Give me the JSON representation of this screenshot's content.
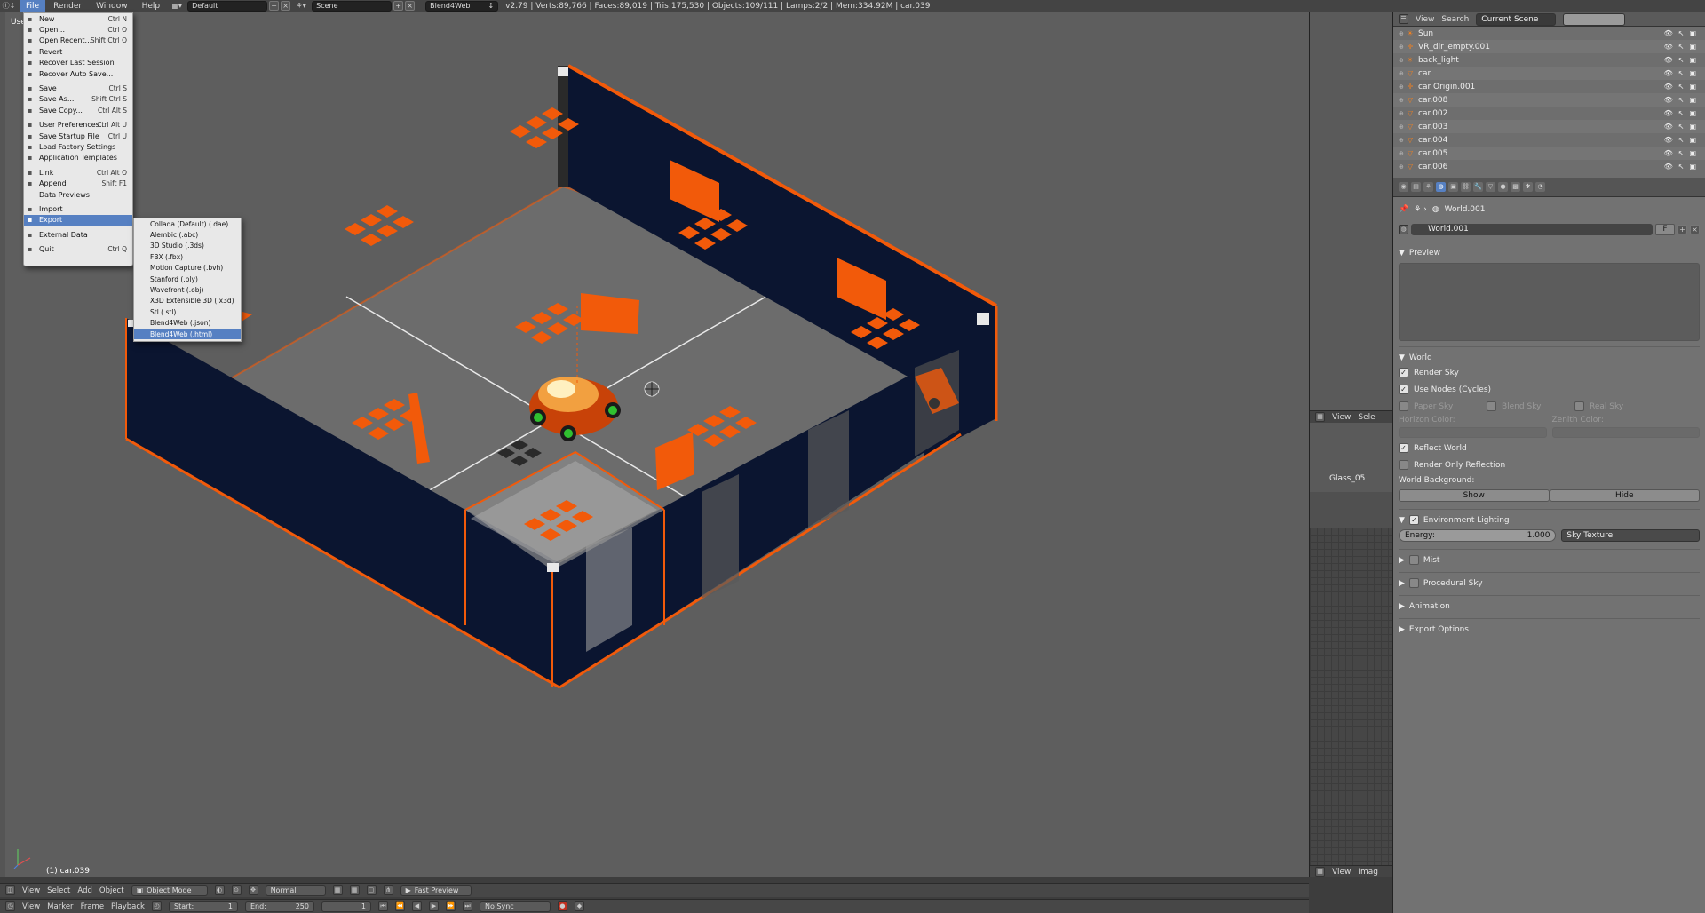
{
  "topbar": {
    "menus": [
      "File",
      "Render",
      "Window",
      "Help"
    ],
    "layout": "Default",
    "scene": "Scene",
    "engine": "Blend4Web",
    "stats": "v2.79 | Verts:89,766 | Faces:89,019 | Tris:175,530 | Objects:109/111 | Lamps:2/2 | Mem:334.92M | car.039"
  },
  "viewport": {
    "view_label": "User",
    "object_label": "(1) car.039"
  },
  "file_menu": {
    "items": [
      {
        "label": "New",
        "shortcut": "Ctrl N",
        "icon": "new-file-icon"
      },
      {
        "label": "Open...",
        "shortcut": "Ctrl O",
        "icon": "folder-icon"
      },
      {
        "label": "Open Recent...",
        "shortcut": "Shift Ctrl O",
        "icon": "folder-icon"
      },
      {
        "label": "Revert",
        "shortcut": "",
        "icon": "revert-icon"
      },
      {
        "label": "Recover Last Session",
        "shortcut": "",
        "icon": "recover-icon"
      },
      {
        "label": "Recover Auto Save...",
        "shortcut": "",
        "icon": "recover-icon"
      },
      {
        "label": "Save",
        "shortcut": "Ctrl S",
        "icon": "save-icon"
      },
      {
        "label": "Save As...",
        "shortcut": "Shift Ctrl S",
        "icon": "save-icon"
      },
      {
        "label": "Save Copy...",
        "shortcut": "Ctrl Alt S",
        "icon": "save-icon"
      },
      {
        "label": "User Preferences...",
        "shortcut": "Ctrl Alt U",
        "icon": "prefs-icon"
      },
      {
        "label": "Save Startup File",
        "shortcut": "Ctrl U",
        "icon": "save-icon"
      },
      {
        "label": "Load Factory Settings",
        "shortcut": "",
        "icon": "settings-icon"
      },
      {
        "label": "Application Templates",
        "shortcut": "",
        "icon": "template-icon"
      },
      {
        "label": "Link",
        "shortcut": "Ctrl Alt O",
        "icon": "link-icon"
      },
      {
        "label": "Append",
        "shortcut": "Shift F1",
        "icon": "append-icon"
      },
      {
        "label": "Data Previews",
        "shortcut": "",
        "icon": ""
      },
      {
        "label": "Import",
        "shortcut": "",
        "icon": "import-icon"
      },
      {
        "label": "Export",
        "shortcut": "",
        "icon": "export-icon"
      },
      {
        "label": "External Data",
        "shortcut": "",
        "icon": "external-icon"
      },
      {
        "label": "Quit",
        "shortcut": "Ctrl Q",
        "icon": "quit-icon"
      }
    ]
  },
  "export_menu": {
    "items": [
      "Collada (Default) (.dae)",
      "Alembic (.abc)",
      "3D Studio (.3ds)",
      "FBX (.fbx)",
      "Motion Capture (.bvh)",
      "Stanford (.ply)",
      "Wavefront (.obj)",
      "X3D Extensible 3D (.x3d)",
      "Stl (.stl)",
      "Blend4Web (.json)",
      "Blend4Web (.html)"
    ]
  },
  "middle_panel": {
    "label": "Glass_05",
    "bar1": [
      "View",
      "Sele"
    ],
    "bar2": [
      "View",
      "Imag"
    ]
  },
  "outliner": {
    "header": [
      "View",
      "Search",
      "Current Scene"
    ],
    "rows": [
      "Sun",
      "VR_dir_empty.001",
      "back_light",
      "car",
      "car Origin.001",
      "car.008",
      "car.002",
      "car.003",
      "car.004",
      "car.005",
      "car.006"
    ]
  },
  "properties": {
    "breadcrumb": "World.001",
    "world_name": "World.001",
    "f_label": "F",
    "preview": "Preview",
    "world": "World",
    "render_sky": "Render Sky",
    "use_nodes": "Use Nodes (Cycles)",
    "paper_sky": "Paper Sky",
    "blend_sky": "Blend Sky",
    "real_sky": "Real Sky",
    "horizon_color": "Horizon Color:",
    "zenith_color": "Zenith Color:",
    "reflect_world": "Reflect World",
    "render_only_reflection": "Render Only Reflection",
    "world_background": "World Background:",
    "show": "Show",
    "hide": "Hide",
    "env_lighting": "Environment Lighting",
    "energy_label": "Energy:",
    "energy_value": "1.000",
    "sky_texture": "Sky Texture",
    "mist": "Mist",
    "procedural_sky": "Procedural Sky",
    "animation": "Animation",
    "export_options": "Export Options"
  },
  "bottom1": {
    "items": [
      "View",
      "Select",
      "Add",
      "Object"
    ],
    "mode": "Object Mode",
    "shading": "Normal",
    "fast_preview": "Fast Preview"
  },
  "bottom2": {
    "items": [
      "View",
      "Marker",
      "Frame",
      "Playback"
    ],
    "start_label": "Start:",
    "start": "1",
    "end_label": "End:",
    "end": "250",
    "current": "1",
    "sync": "No Sync"
  },
  "colors": {
    "accent": "#5680c2",
    "orange": "#f25a0a",
    "navy": "#0b1530",
    "floor": "#6a6a6a"
  }
}
